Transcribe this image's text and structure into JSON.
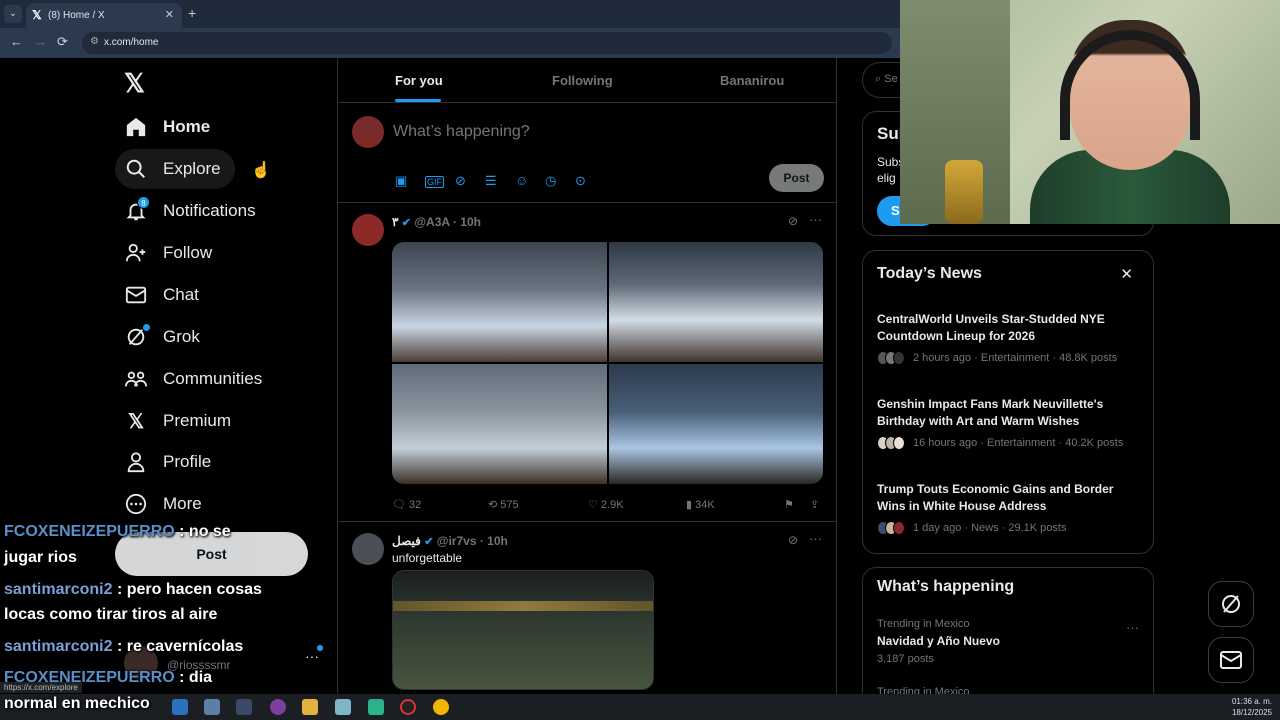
{
  "browser": {
    "tab_title": "(8) Home / X",
    "tab_favicon": "𝕏",
    "tab_close": "✕",
    "tab_list": "⌄",
    "new_tab": "+",
    "url": "x.com/home",
    "back": "←",
    "forward": "→",
    "reload": "⟳",
    "status_url": "https://x.com/explore"
  },
  "logo": "𝕏",
  "nav": {
    "home": "Home",
    "explore": "Explore",
    "notifications": "Notifications",
    "notifications_badge": "8",
    "follow": "Follow",
    "chat": "Chat",
    "grok": "Grok",
    "communities": "Communities",
    "premium": "Premium",
    "profile": "Profile",
    "more": "More",
    "post_button": "Post"
  },
  "account": {
    "handle": "@riossssmr",
    "more": "···"
  },
  "chat_overlay": [
    {
      "user": "FCOXENEIZEPUERRO",
      "msg": ": no se"
    },
    {
      "user": "",
      "msg": "jugar rios"
    },
    {
      "user": "santimarconi2",
      "msg": ": pero hacen cosas"
    },
    {
      "user": "",
      "msg": "locas como tirar tiros al aire"
    },
    {
      "user": "santimarconi2",
      "msg": ": re cavernícolas"
    },
    {
      "user": "FCOXENEIZEPUERRO",
      "msg": ": dia"
    },
    {
      "user": "",
      "msg": "normal en mechico"
    }
  ],
  "feed_tabs": {
    "for_you": "For you",
    "following": "Following",
    "custom": "Bananirou"
  },
  "composer": {
    "placeholder": "What’s happening?",
    "post": "Post"
  },
  "tweets": [
    {
      "name": "٣",
      "verified": "✔",
      "handle": "@A3A",
      "time": "· 10h",
      "text": "",
      "replies": "32",
      "reposts": "575",
      "likes": "2.9K",
      "views": "34K"
    },
    {
      "name": "فيصل",
      "verified": "✔",
      "handle": "@ir7vs",
      "time": "· 10h",
      "text": "unforgettable"
    }
  ],
  "sidebar": {
    "search_placeholder": "Se",
    "subscribe": {
      "title": "Sub",
      "text_line1": "Subs",
      "text_line2": "elig",
      "button": "S"
    },
    "news": {
      "title": "Today’s News",
      "close": "✕",
      "items": [
        {
          "headline": "CentralWorld Unveils Star-Studded NYE Countdown Lineup for 2026",
          "meta": "2 hours ago · Entertainment · 48.8K posts"
        },
        {
          "headline": "Genshin Impact Fans Mark Neuvillette's Birthday with Art and Warm Wishes",
          "meta": "16 hours ago · Entertainment · 40.2K posts"
        },
        {
          "headline": "Trump Touts Economic Gains and Border Wins in White House Address",
          "meta": "1 day ago · News · 29.1K posts"
        }
      ]
    },
    "whats_happening": {
      "title": "What’s happening",
      "context": "Trending in Mexico",
      "topic": "Navidad y Año Nuevo",
      "count": "3,187 posts",
      "context2": "Trending in Mexico",
      "more": "···"
    }
  },
  "taskbar": {
    "time": "01:36 a. m.",
    "date": "18/12/2025"
  },
  "colors": {
    "accent": "#1d9bf0",
    "border": "#2f3336",
    "muted": "#71767b"
  }
}
